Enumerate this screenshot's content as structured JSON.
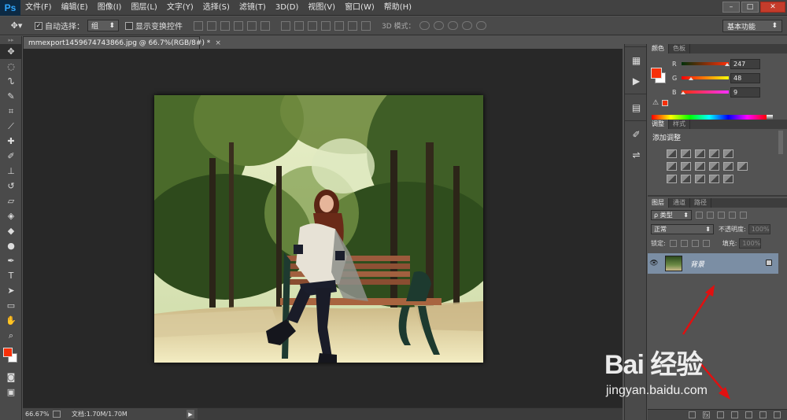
{
  "app": {
    "logo": "Ps"
  },
  "menu": [
    "文件(F)",
    "编辑(E)",
    "图像(I)",
    "图层(L)",
    "文字(Y)",
    "选择(S)",
    "滤镜(T)",
    "3D(D)",
    "视图(V)",
    "窗口(W)",
    "帮助(H)"
  ],
  "window_controls": {
    "minimize": "–",
    "restore": "□",
    "close": "✕"
  },
  "options_bar": {
    "auto_select_label": "自动选择：",
    "auto_select_checked": "✓",
    "auto_select_value": "组",
    "show_transform_label": "显示变换控件",
    "mode_3d_label": "3D 模式：",
    "workspace": "基本功能"
  },
  "document": {
    "tab_title": "mmexport1459674743866.jpg @ 66.7%(RGB/8#) *",
    "tab_close": "×"
  },
  "status": {
    "zoom": "66.67%",
    "doc_size": "文档:1.70M/1.70M"
  },
  "colors": {
    "foreground": "#f73009",
    "background": "#ffffff",
    "accent_arrow": "#e01010"
  },
  "color_panel": {
    "tabs": [
      "颜色",
      "色板"
    ],
    "r": {
      "label": "R",
      "value": "247"
    },
    "g": {
      "label": "G",
      "value": "48"
    },
    "b": {
      "label": "B",
      "value": "9"
    },
    "gamut_warning": "⚠"
  },
  "adjustments_panel": {
    "tabs": [
      "调整",
      "样式"
    ],
    "title": "添加调整"
  },
  "layers_panel": {
    "tabs": [
      "图层",
      "通道",
      "路径"
    ],
    "filter": "ρ 类型",
    "blend_mode": "正常",
    "opacity_label": "不透明度:",
    "opacity_value": "100%",
    "lock_label": "锁定:",
    "fill_label": "填充:",
    "fill_value": "100%",
    "layer": {
      "name": "背景",
      "visible": "👁"
    }
  },
  "watermark": {
    "brand": "Bai 经验",
    "url": "jingyan.baidu.com"
  }
}
